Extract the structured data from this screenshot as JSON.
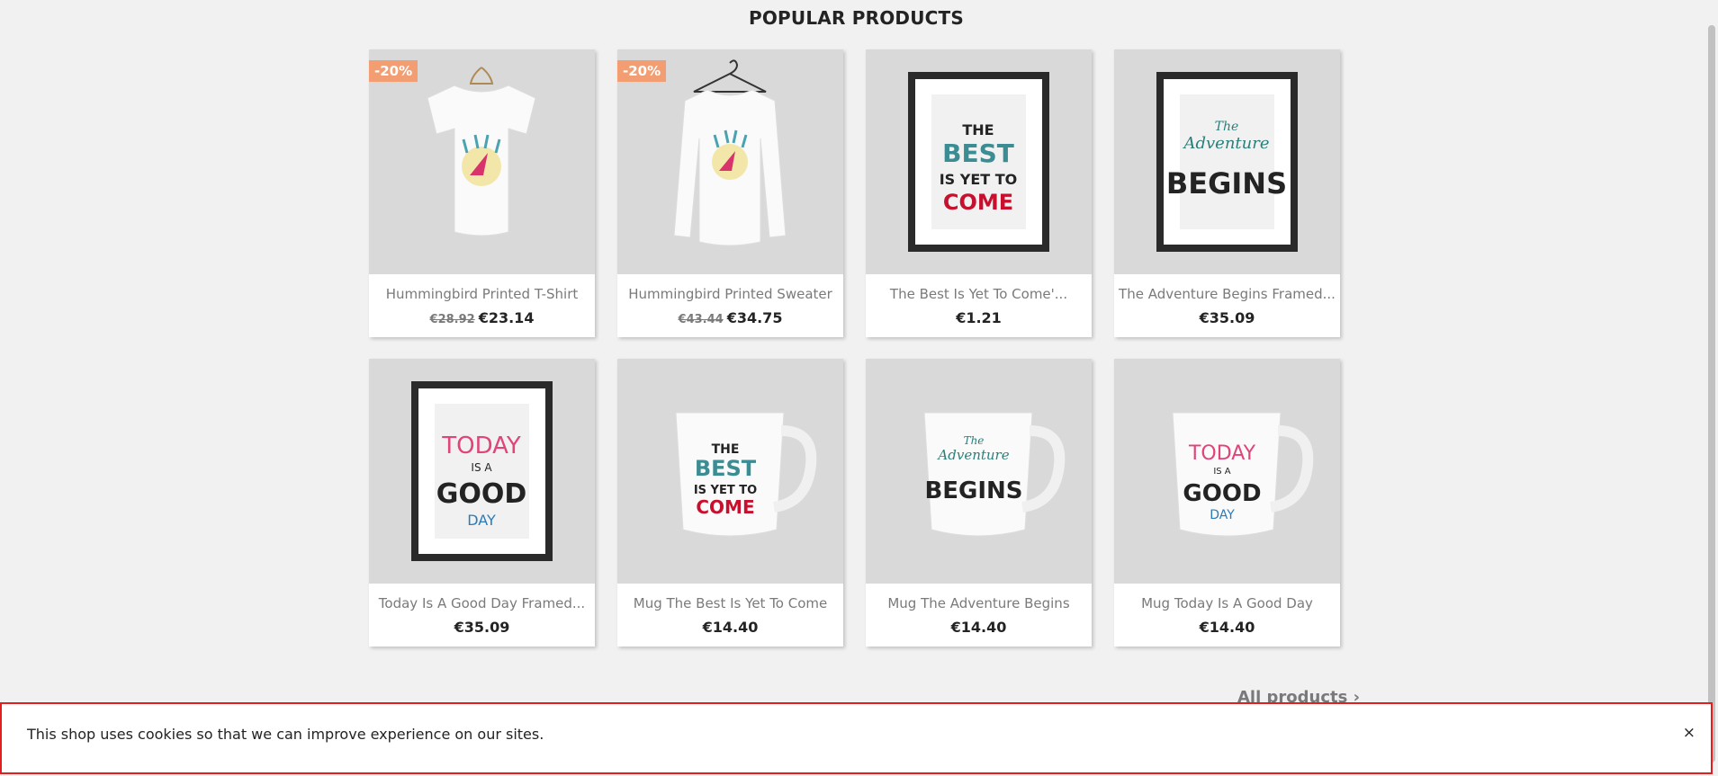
{
  "section_title": "POPULAR PRODUCTS",
  "products": [
    {
      "name": "Hummingbird Printed T-Shirt",
      "old_price": "€28.92",
      "price": "€23.14",
      "badge": "-20%",
      "icon": "tshirt-icon"
    },
    {
      "name": "Hummingbird Printed Sweater",
      "old_price": "€43.44",
      "price": "€34.75",
      "badge": "-20%",
      "icon": "sweater-icon"
    },
    {
      "name": "The Best Is Yet To Come'...",
      "price": "€1.21",
      "icon": "poster-best-icon"
    },
    {
      "name": "The Adventure Begins Framed...",
      "price": "€35.09",
      "icon": "poster-adventure-icon"
    },
    {
      "name": "Today Is A Good Day Framed...",
      "price": "€35.09",
      "icon": "poster-today-icon"
    },
    {
      "name": "Mug The Best Is Yet To Come",
      "price": "€14.40",
      "icon": "mug-best-icon"
    },
    {
      "name": "Mug The Adventure Begins",
      "price": "€14.40",
      "icon": "mug-adventure-icon"
    },
    {
      "name": "Mug Today Is A Good Day",
      "price": "€14.40",
      "icon": "mug-today-icon"
    }
  ],
  "all_products_link": "All products",
  "cookie_banner": {
    "text": "This shop uses cookies so that we can improve experience on our sites.",
    "close_label": "×"
  },
  "colors": {
    "badge": "#f39d72",
    "cookie_border": "#e31e1e",
    "teal": "#3c8d93",
    "red": "#c8102e",
    "pink": "#e0447a"
  }
}
